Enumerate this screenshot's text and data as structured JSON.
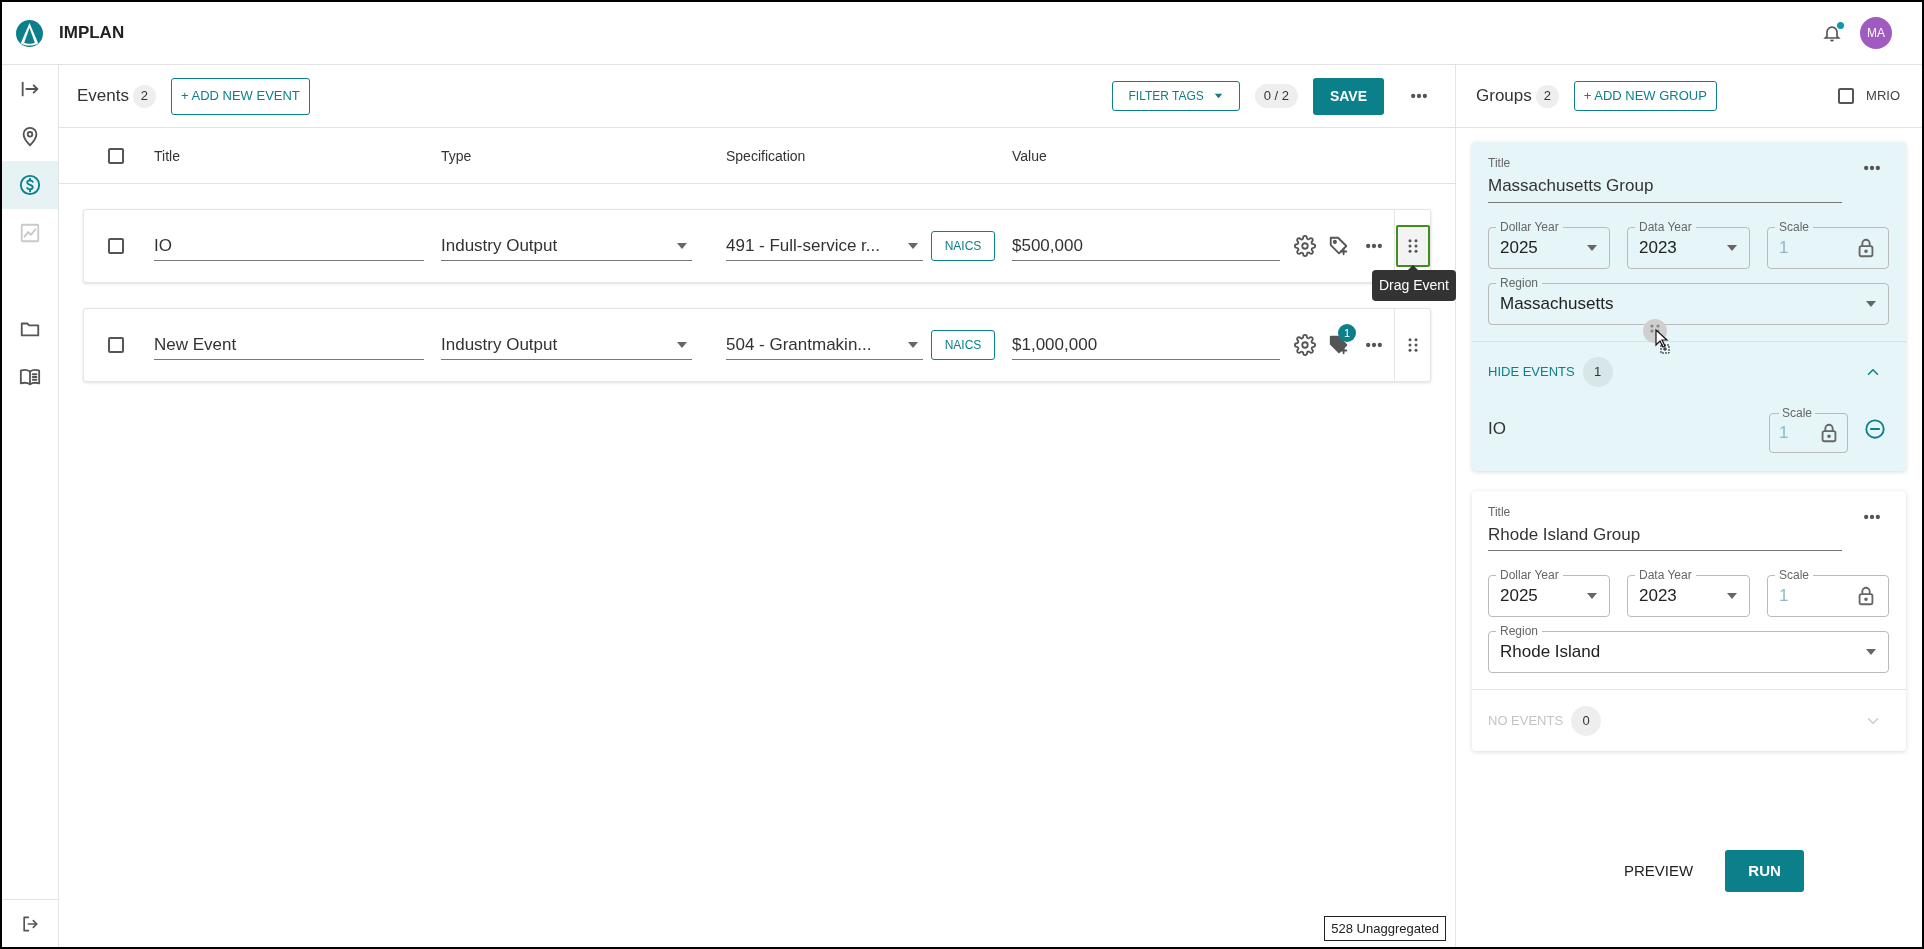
{
  "app": {
    "name": "IMPLAN"
  },
  "header": {
    "notification_dot": true,
    "avatar": "MA"
  },
  "sidebar": {
    "items": [
      {
        "kind": "expand",
        "selected": false,
        "disabled": false
      },
      {
        "kind": "location",
        "selected": false,
        "disabled": false
      },
      {
        "kind": "dollar",
        "selected": true,
        "disabled": false
      },
      {
        "kind": "chart",
        "selected": false,
        "disabled": true
      },
      {
        "kind": "folder",
        "selected": false,
        "disabled": false
      },
      {
        "kind": "book",
        "selected": false,
        "disabled": false
      }
    ],
    "bottom_item": {
      "kind": "logout"
    }
  },
  "events_panel": {
    "title": "Events",
    "count": "2",
    "add_button": "+ ADD NEW EVENT",
    "filter_button": "FILTER TAGS",
    "selection_count": "0 / 2",
    "save_button": "SAVE"
  },
  "table": {
    "select_all_checked": false,
    "columns": [
      "Title",
      "Type",
      "Specification",
      "Value"
    ],
    "rows": [
      {
        "checked": false,
        "title": "IO",
        "type": "Industry Output",
        "specification": "491 - Full-service r...",
        "code_system": "NAICS",
        "value": "$500,000",
        "tag_badge": null,
        "drag_focused": true,
        "drag_tooltip": "Drag Event"
      },
      {
        "checked": false,
        "title": "New Event",
        "type": "Industry Output",
        "specification": "504 - Grantmakin...",
        "code_system": "NAICS",
        "value": "$1,000,000",
        "tag_badge": "1",
        "drag_focused": false,
        "drag_tooltip": null
      }
    ]
  },
  "status": "528 Unaggregated",
  "groups_panel": {
    "title": "Groups",
    "count": "2",
    "add_button": "+ ADD NEW GROUP",
    "mrio": {
      "label": "MRIO",
      "checked": false
    },
    "groups": [
      {
        "highlighted": true,
        "title_label": "Title",
        "title": "Massachusetts Group",
        "dollar_year": {
          "label": "Dollar Year",
          "value": "2025"
        },
        "data_year": {
          "label": "Data Year",
          "value": "2023"
        },
        "scale": {
          "label": "Scale",
          "value": "1"
        },
        "region": {
          "label": "Region",
          "value": "Massachusetts"
        },
        "events_toggle": {
          "label": "HIDE EVENTS",
          "count": "1",
          "expanded": true,
          "disabled": false
        },
        "events": [
          {
            "title": "IO",
            "scale_label": "Scale",
            "scale": "1"
          }
        ]
      },
      {
        "highlighted": false,
        "title_label": "Title",
        "title": "Rhode Island Group",
        "dollar_year": {
          "label": "Dollar Year",
          "value": "2025"
        },
        "data_year": {
          "label": "Data Year",
          "value": "2023"
        },
        "scale": {
          "label": "Scale",
          "value": "1"
        },
        "region": {
          "label": "Region",
          "value": "Rhode Island"
        },
        "events_toggle": {
          "label": "NO EVENTS",
          "count": "0",
          "expanded": false,
          "disabled": true
        }
      }
    ]
  },
  "footer": {
    "preview_button": "PREVIEW",
    "run_button": "RUN"
  }
}
